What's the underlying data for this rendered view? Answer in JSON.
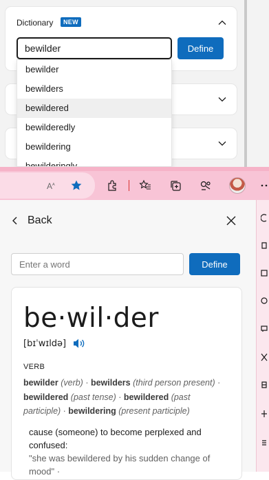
{
  "widget": {
    "title": "Dictionary",
    "badge": "NEW",
    "input_value": "bewilder",
    "define_label": "Define",
    "suggestions": [
      "bewilder",
      "bewilders",
      "bewildered",
      "bewilderedly",
      "bewildering",
      "bewilderingly"
    ]
  },
  "toolbar": {
    "icons": [
      "read-aloud-icon",
      "favorite-star-icon",
      "extensions-icon",
      "favorites-icon",
      "collections-icon",
      "browser-essentials-icon",
      "profile-avatar",
      "more-icon"
    ],
    "colors": {
      "toolbar_bg": "#f8c4d6",
      "accent_blue": "#0f6cbd"
    }
  },
  "panel": {
    "back_label": "Back",
    "input_placeholder": "Enter a word",
    "define_label": "Define",
    "headword": "be·wil·der",
    "pronunciation": "[bɪˈwɪldə]",
    "part_of_speech": "VERB",
    "forms": [
      {
        "word": "bewilder",
        "note": "(verb)"
      },
      {
        "word": "bewilders",
        "note": "(third person present)"
      },
      {
        "word": "bewildered",
        "note": "(past tense)"
      },
      {
        "word": "bewildered",
        "note": "(past participle)"
      },
      {
        "word": "bewildering",
        "note": "(present participle)"
      }
    ],
    "definition": "cause (someone) to become perplexed and confused:",
    "example": "\"she was bewildered by his sudden change of mood\" ·"
  }
}
